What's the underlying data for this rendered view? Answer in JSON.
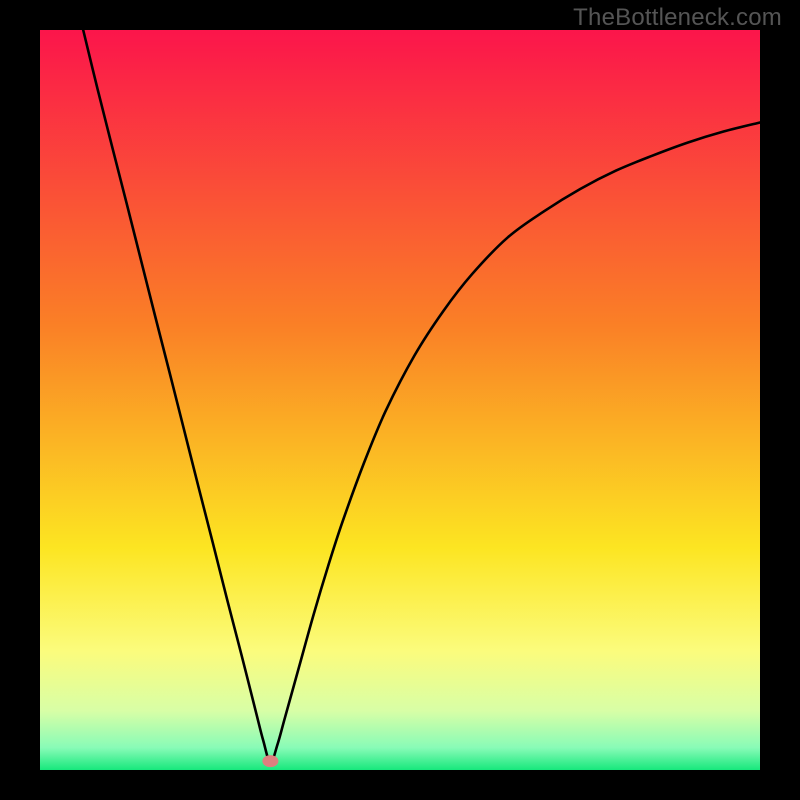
{
  "watermark": "TheBottleneck.com",
  "chart_data": {
    "type": "line",
    "title": "",
    "xlabel": "",
    "ylabel": "",
    "xlim": [
      0,
      100
    ],
    "ylim": [
      0,
      100
    ],
    "grid": false,
    "legend": false,
    "marker": {
      "x": 32,
      "y": 1.2,
      "color": "#dd7f7f"
    },
    "background_gradient": {
      "stops": [
        {
          "offset": 0,
          "color": "#fb154b"
        },
        {
          "offset": 0.4,
          "color": "#fa8026"
        },
        {
          "offset": 0.7,
          "color": "#fce522"
        },
        {
          "offset": 0.84,
          "color": "#fbfc7d"
        },
        {
          "offset": 0.92,
          "color": "#d8fea6"
        },
        {
          "offset": 0.97,
          "color": "#88fbb7"
        },
        {
          "offset": 1.0,
          "color": "#17e87c"
        }
      ]
    },
    "series": [
      {
        "name": "curve",
        "x": [
          6,
          8,
          10,
          12,
          14,
          16,
          18,
          20,
          22,
          24,
          26,
          28,
          30,
          31,
          32,
          33,
          34,
          36,
          38,
          40,
          42,
          45,
          48,
          52,
          56,
          60,
          65,
          70,
          75,
          80,
          85,
          90,
          95,
          100
        ],
        "y": [
          100,
          92,
          84.3,
          76.7,
          69,
          61.3,
          53.7,
          46,
          38.3,
          30.7,
          23,
          15.5,
          7.8,
          4,
          1,
          3.5,
          7,
          14,
          21,
          27.5,
          33.5,
          41.5,
          48.5,
          56,
          62,
          67,
          72,
          75.5,
          78.5,
          81,
          83,
          84.8,
          86.3,
          87.5
        ]
      }
    ]
  }
}
